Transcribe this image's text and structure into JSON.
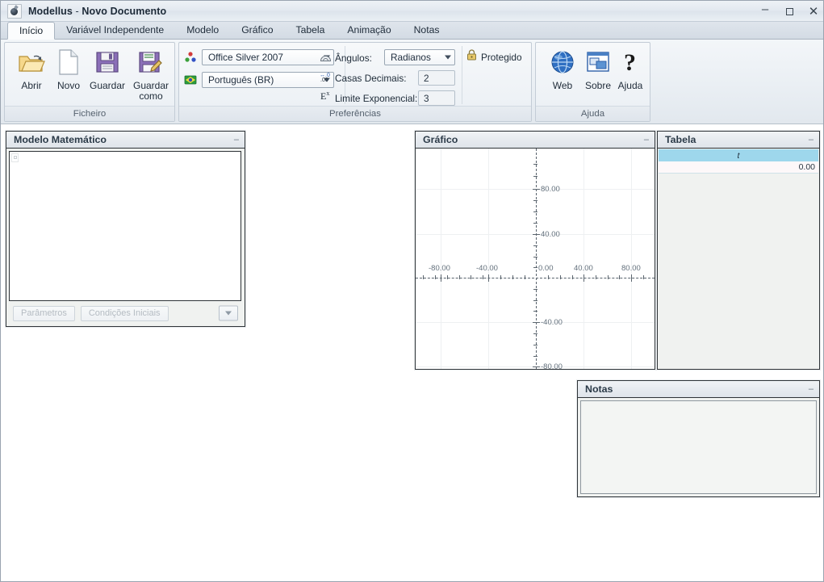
{
  "window": {
    "title_app": "Modellus",
    "title_sep": " - ",
    "title_doc": "Novo Documento",
    "app_icon": "flask-icon",
    "buttons": {
      "minimize": "minimize-icon",
      "maximize": "maximize-icon",
      "close": "✕"
    }
  },
  "tabs": [
    {
      "label": "Início",
      "active": true
    },
    {
      "label": "Variável Independente",
      "active": false
    },
    {
      "label": "Modelo",
      "active": false
    },
    {
      "label": "Gráfico",
      "active": false
    },
    {
      "label": "Tabela",
      "active": false
    },
    {
      "label": "Animação",
      "active": false
    },
    {
      "label": "Notas",
      "active": false
    }
  ],
  "ribbon": {
    "groups": [
      {
        "id": "ficheiro",
        "title": "Ficheiro"
      },
      {
        "id": "preferencias",
        "title": "Preferências"
      },
      {
        "id": "ajuda",
        "title": "Ajuda"
      }
    ],
    "ficheiro": {
      "buttons": [
        {
          "label": "Abrir",
          "icon": "open-folder-icon"
        },
        {
          "label": "Novo",
          "icon": "new-document-icon"
        },
        {
          "label": "Guardar",
          "icon": "save-diskette-icon"
        },
        {
          "label": "Guardar como",
          "icon": "save-as-diskette-pencil-icon"
        }
      ]
    },
    "preferencias": {
      "theme": {
        "icon": "color-balls-icon",
        "value": "Office Silver 2007"
      },
      "language": {
        "icon": "brazil-flag-icon",
        "value": "Português (BR)"
      },
      "angles": {
        "icon": "protractor-icon",
        "label": "Ângulos:",
        "value": "Radianos"
      },
      "decimals": {
        "icon": "decimal-places-icon",
        "label": "Casas Decimais:",
        "value": "2"
      },
      "exponent": {
        "icon": "exponent-icon",
        "label": "Limite Exponencial:",
        "value": "3"
      },
      "protected": {
        "icon": "lock-icon",
        "label": "Protegido",
        "checked": false
      }
    },
    "ajuda": {
      "buttons": [
        {
          "label": "Web",
          "icon": "globe-icon"
        },
        {
          "label": "Sobre",
          "icon": "about-window-icon"
        },
        {
          "label": "Ajuda",
          "icon": "question-mark-icon"
        }
      ]
    }
  },
  "panels": {
    "model": {
      "title": "Modelo Matemático",
      "collapse": "–",
      "content": "",
      "footer": {
        "parameters_label": "Parâmetros",
        "initial_conditions_label": "Condições Iniciais",
        "dropdown_icon": "chevron-down-icon"
      }
    },
    "graph": {
      "title": "Gráfico",
      "collapse": "–"
    },
    "table": {
      "title": "Tabela",
      "collapse": "–",
      "columns": [
        "t"
      ],
      "rows": [
        [
          "0.00"
        ]
      ]
    },
    "notes": {
      "title": "Notas",
      "collapse": "–",
      "content": ""
    }
  },
  "chart_data": {
    "type": "scatter",
    "title": "Gráfico",
    "xlabel": "",
    "ylabel": "",
    "xlim": [
      -110,
      110
    ],
    "ylim": [
      -110,
      110
    ],
    "x_ticks": [
      "-80.00",
      "-40.00",
      "0.00",
      "40.00",
      "80.00"
    ],
    "x_tick_values": [
      -80,
      -40,
      0,
      40,
      80
    ],
    "y_ticks": [
      "80.00",
      "40.00",
      "-40.00",
      "-80.00"
    ],
    "y_tick_values": [
      80,
      40,
      -40,
      -80
    ],
    "grid": true,
    "series": [],
    "legend": "none",
    "axis_style": "dashed-crosshair"
  },
  "colors": {
    "titlebar": "#e6ebf1",
    "ribbon": "#edf1f5",
    "panel_header": "#e8ecf1",
    "panel_body": "#f0f2f0",
    "table_header": "#9ed7ec",
    "tab_active": "#fbfcfd",
    "text": "#1e2b38",
    "axis": "#5c666f",
    "grid": "#eef0f2"
  }
}
